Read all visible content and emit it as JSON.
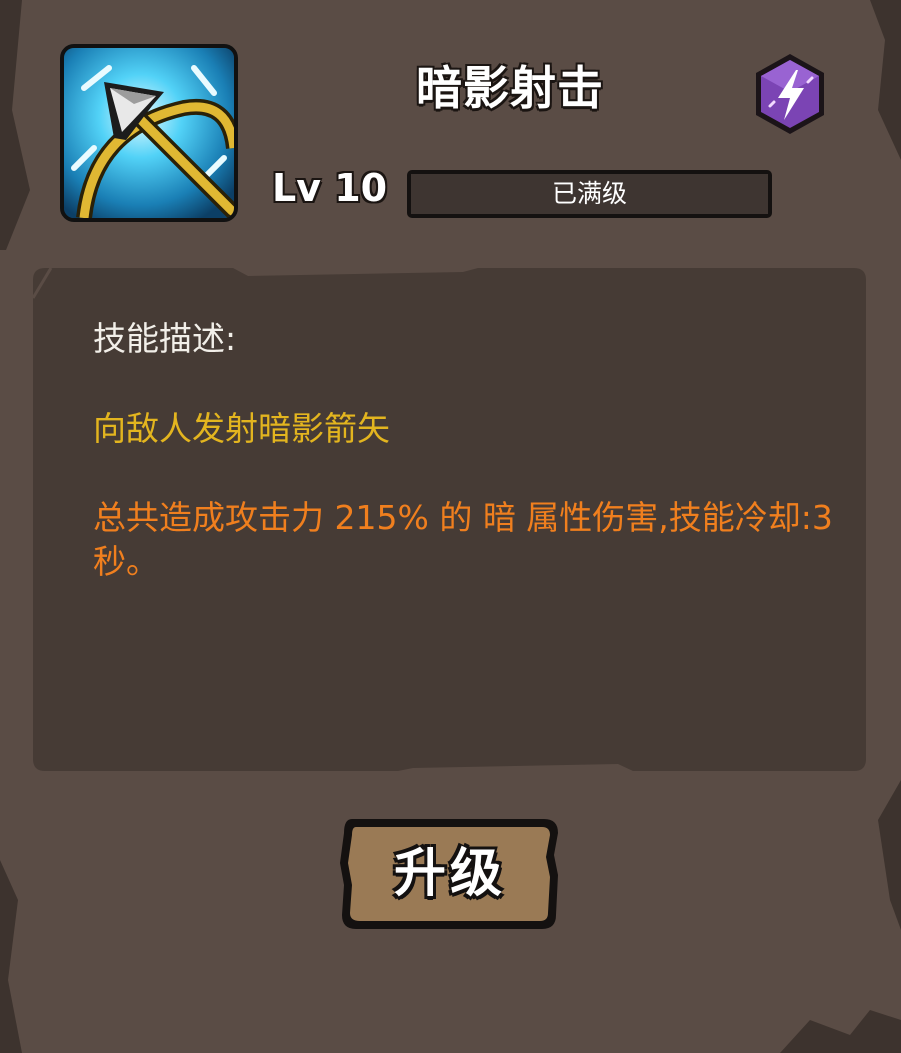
{
  "skill": {
    "name": "暗影射击",
    "icon": "shadow-arrow-icon",
    "element_icon": "lightning-icon",
    "element_color": "#7b44b4"
  },
  "level": {
    "label": "Lv 10",
    "status": "已满级",
    "progress": 1.0
  },
  "description": {
    "heading": "技能描述:",
    "summary": "向敌人发射暗影箭矢",
    "details": "总共造成攻击力 215% 的 暗 属性伤害,技能冷却:3秒。",
    "summary_color": "#e3b51f",
    "details_color": "#f07f1e"
  },
  "actions": {
    "upgrade_label": "升级"
  },
  "colors": {
    "panel": "#5a4c45",
    "inner_box": "#463b35",
    "button": "#9a7a55"
  }
}
